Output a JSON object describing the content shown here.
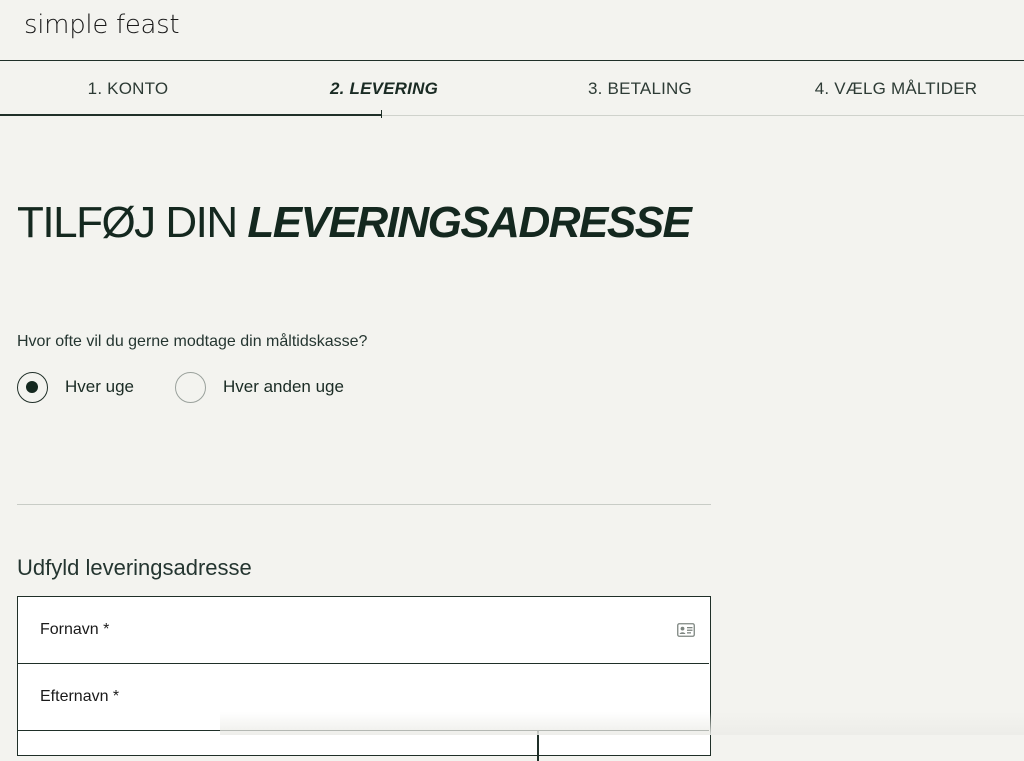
{
  "brand": {
    "logo_text": "simple feast"
  },
  "steps": [
    {
      "label": "1. KONTO"
    },
    {
      "label": "2. LEVERING"
    },
    {
      "label": "3. BETALING"
    },
    {
      "label": "4. VÆLG MÅLTIDER"
    }
  ],
  "progress": {
    "current_step": 2,
    "total_steps": 4
  },
  "heading": {
    "plain": "TILFØJ DIN ",
    "emphasis": "LEVERINGSADRESSE"
  },
  "frequency": {
    "question": "Hvor ofte vil du gerne modtage din måltidskasse?",
    "options": [
      {
        "label": "Hver uge",
        "selected": true
      },
      {
        "label": "Hver anden uge",
        "selected": false
      }
    ]
  },
  "address": {
    "section_title": "Udfyld leveringsadresse",
    "fields": [
      {
        "placeholder": "Fornavn *",
        "value": "",
        "icon": "contact-card-icon"
      },
      {
        "placeholder": "Efternavn *",
        "value": ""
      }
    ]
  },
  "colors": {
    "ink": "#14281f",
    "background": "#f3f3ef",
    "border": "#1f2f28"
  }
}
